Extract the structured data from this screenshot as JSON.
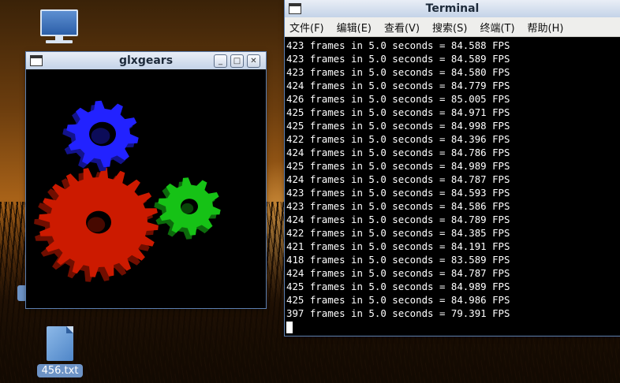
{
  "desktop": {
    "icons": [
      {
        "name": "computer",
        "label": ""
      },
      {
        "name": "file",
        "label": "456.txt"
      }
    ]
  },
  "glxgears": {
    "title": "glxgears",
    "controls": {
      "minimize": "_",
      "maximize": "□",
      "close": "✕"
    },
    "gears": [
      {
        "color": "#2222ff"
      },
      {
        "color": "#cc1a00"
      },
      {
        "color": "#16c216"
      }
    ]
  },
  "terminal": {
    "title": "Terminal",
    "menu": [
      "文件(F)",
      "编辑(E)",
      "查看(V)",
      "搜索(S)",
      "终端(T)",
      "帮助(H)"
    ],
    "lines": [
      "423 frames in 5.0 seconds = 84.588 FPS",
      "423 frames in 5.0 seconds = 84.589 FPS",
      "423 frames in 5.0 seconds = 84.580 FPS",
      "424 frames in 5.0 seconds = 84.779 FPS",
      "426 frames in 5.0 seconds = 85.005 FPS",
      "425 frames in 5.0 seconds = 84.971 FPS",
      "425 frames in 5.0 seconds = 84.998 FPS",
      "422 frames in 5.0 seconds = 84.396 FPS",
      "424 frames in 5.0 seconds = 84.786 FPS",
      "425 frames in 5.0 seconds = 84.989 FPS",
      "424 frames in 5.0 seconds = 84.787 FPS",
      "423 frames in 5.0 seconds = 84.593 FPS",
      "423 frames in 5.0 seconds = 84.586 FPS",
      "424 frames in 5.0 seconds = 84.789 FPS",
      "422 frames in 5.0 seconds = 84.385 FPS",
      "421 frames in 5.0 seconds = 84.191 FPS",
      "418 frames in 5.0 seconds = 83.589 FPS",
      "424 frames in 5.0 seconds = 84.787 FPS",
      "425 frames in 5.0 seconds = 84.989 FPS",
      "425 frames in 5.0 seconds = 84.986 FPS",
      "397 frames in 5.0 seconds = 79.391 FPS"
    ]
  }
}
